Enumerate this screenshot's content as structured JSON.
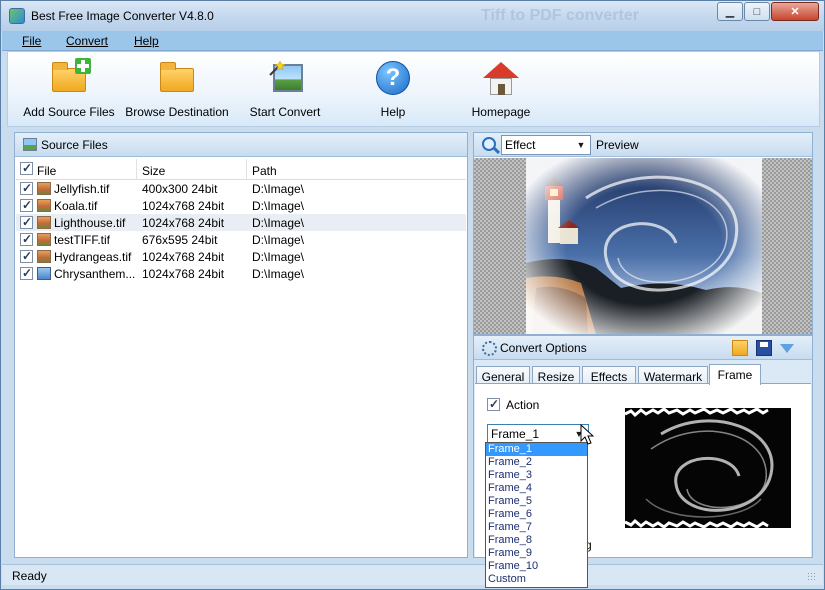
{
  "window": {
    "title": "Best Free Image Converter V4.8.0",
    "ghost_title": "Tiff to PDF converter",
    "minimize_glyph": "▁",
    "maximize_glyph": "□",
    "close_glyph": "✕"
  },
  "menu": {
    "items": [
      {
        "label": "File"
      },
      {
        "label": "Convert"
      },
      {
        "label": "Help"
      }
    ]
  },
  "toolbar": {
    "buttons": [
      {
        "label": "Add Source Files",
        "icon": "folder-add-icon"
      },
      {
        "label": "Browse Destination",
        "icon": "folder-icon"
      },
      {
        "label": "Start Convert",
        "icon": "wand-picture-icon"
      },
      {
        "label": "Help",
        "icon": "help-icon"
      },
      {
        "label": "Homepage",
        "icon": "home-icon"
      }
    ]
  },
  "source_files": {
    "title": "Source Files",
    "columns": [
      "File",
      "Size",
      "Path"
    ],
    "rows": [
      {
        "file": "Jellyfish.tif",
        "size": "400x300  24bit",
        "path": "D:\\Image\\",
        "checked": true
      },
      {
        "file": "Koala.tif",
        "size": "1024x768  24bit",
        "path": "D:\\Image\\",
        "checked": true
      },
      {
        "file": "Lighthouse.tif",
        "size": "1024x768  24bit",
        "path": "D:\\Image\\",
        "checked": true
      },
      {
        "file": "testTIFF.tif",
        "size": "676x595  24bit",
        "path": "D:\\Image\\",
        "checked": true
      },
      {
        "file": "Hydrangeas.tif",
        "size": "1024x768  24bit",
        "path": "D:\\Image\\",
        "checked": true
      },
      {
        "file": "Chrysanthem...",
        "size": "1024x768  24bit",
        "path": "D:\\Image\\",
        "checked": true
      }
    ]
  },
  "preview": {
    "mode_selected": "Effect",
    "label": "Preview"
  },
  "convert_options": {
    "title": "Convert Options",
    "tabs": [
      "General",
      "Resize",
      "Effects",
      "Watermark",
      "Frame"
    ],
    "active_tab": "Frame",
    "action_label": "Action",
    "action_checked": true,
    "frame_selected": "Frame_1",
    "frame_options": [
      "Frame_1",
      "Frame_2",
      "Frame_3",
      "Frame_4",
      "Frame_5",
      "Frame_6",
      "Frame_7",
      "Frame_8",
      "Frame_9",
      "Frame_10",
      "Custom"
    ],
    "hidden_text_fragment": "g"
  },
  "status": {
    "text": "Ready"
  },
  "colors": {
    "menu_bg": "#9cc5ea",
    "selection": "#3399ff",
    "close_button": "#c7452f"
  }
}
